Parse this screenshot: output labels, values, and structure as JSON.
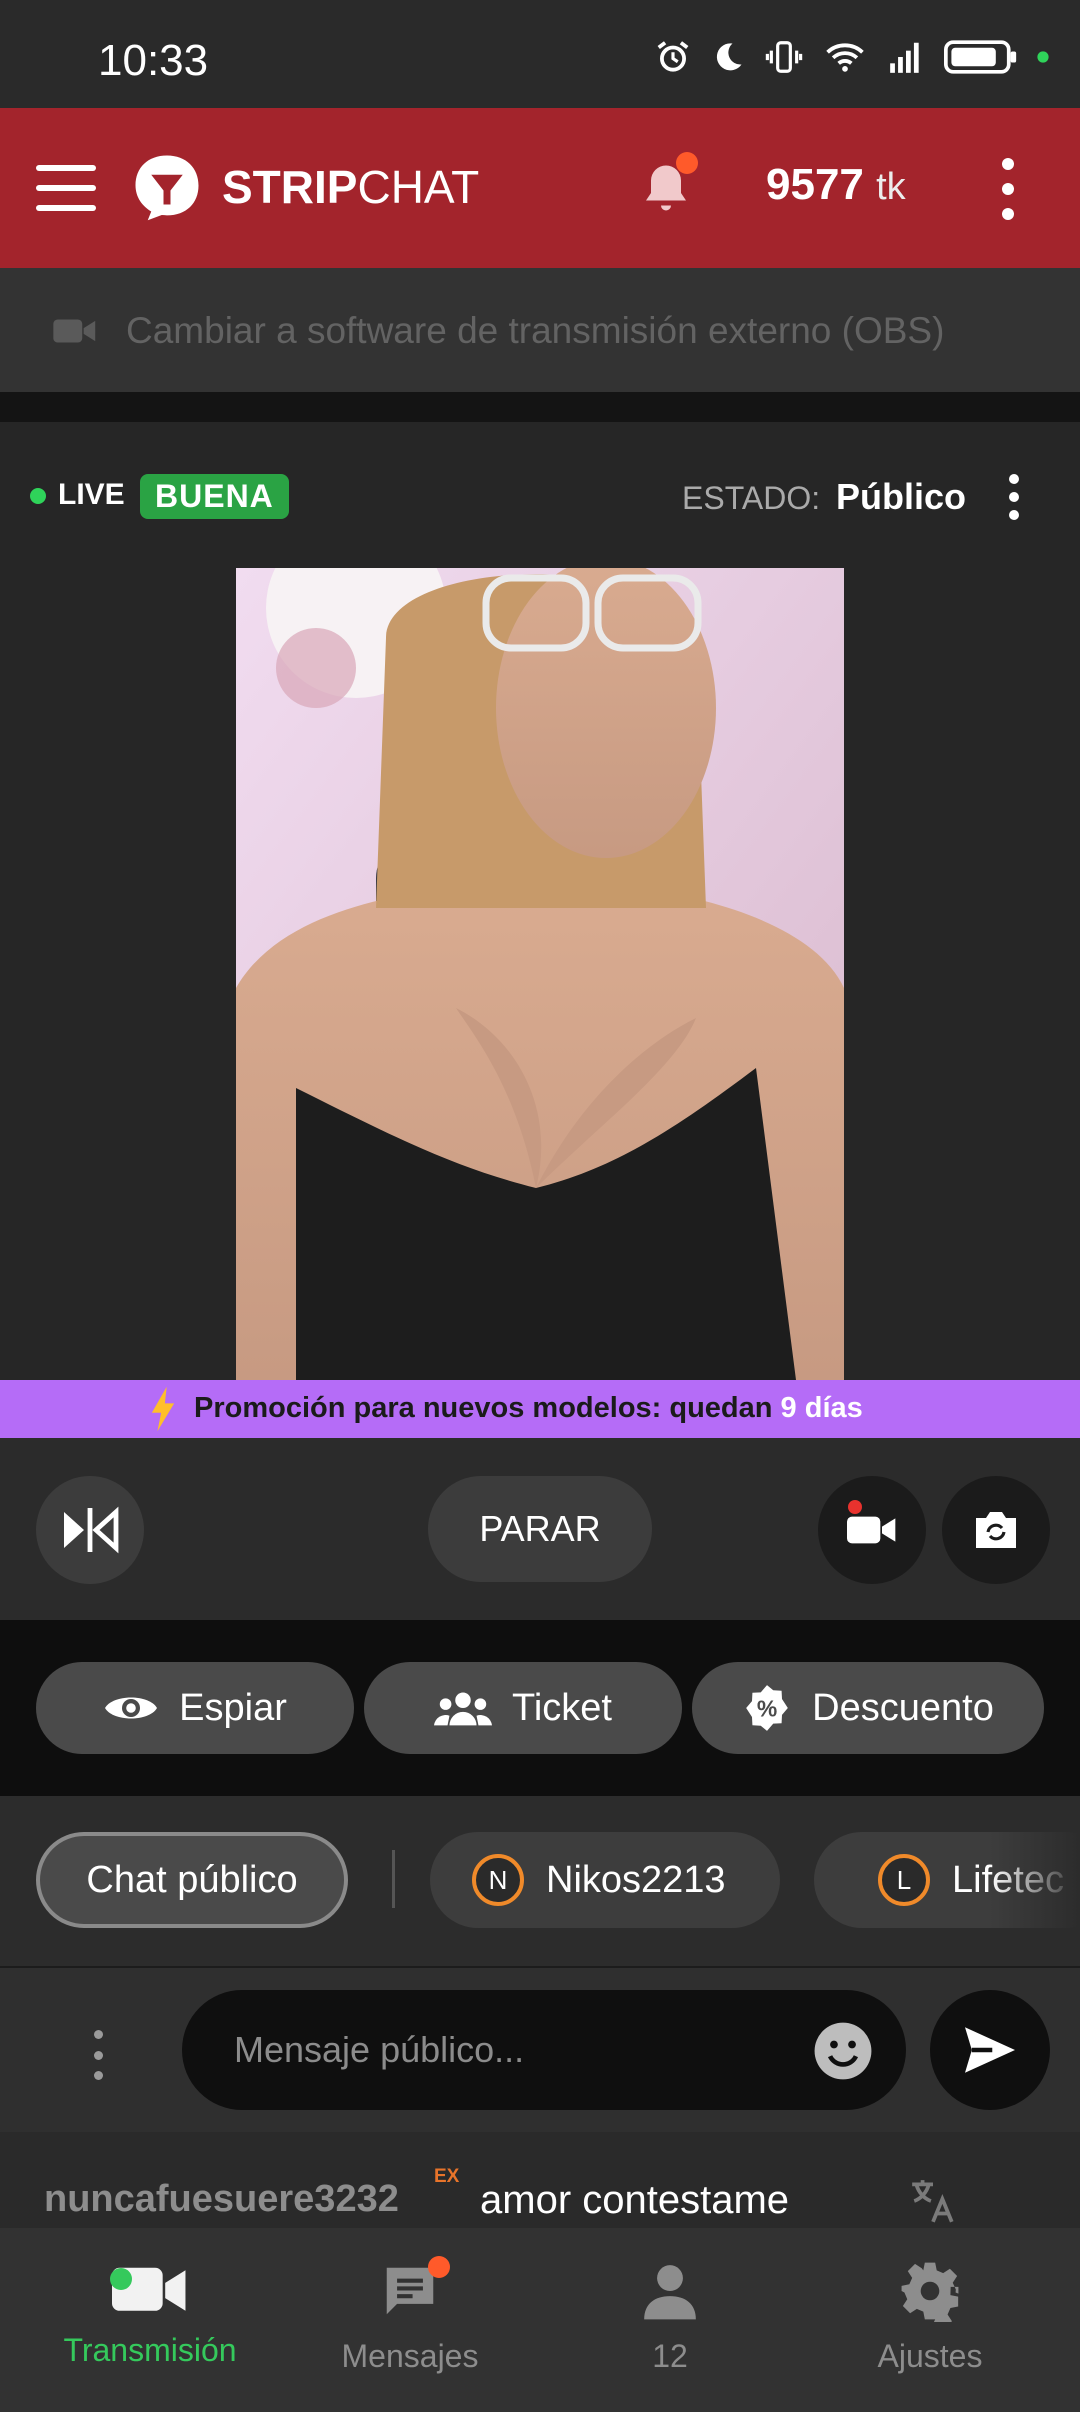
{
  "status_bar": {
    "time": "10:33"
  },
  "header": {
    "brand_part1": "STRIP",
    "brand_part2": "CHAT",
    "tokens_value": "9577",
    "tokens_unit": "tk"
  },
  "obs_bar": {
    "text": "Cambiar a software de transmisión externo (OBS)"
  },
  "live_row": {
    "live_label": "LIVE",
    "quality_badge": "BUENA",
    "estado_label": "ESTADO:",
    "estado_value": "Público"
  },
  "promo": {
    "text_before": "Promoción para nuevos modelos: quedan ",
    "days": "9 días"
  },
  "controls": {
    "stop_label": "PARAR"
  },
  "feature_pills": {
    "spy_label": "Espiar",
    "ticket_label": "Ticket",
    "discount_label": "Descuento"
  },
  "chat_tabs": {
    "public_label": "Chat público",
    "users": [
      {
        "initial": "N",
        "name": "Nikos2213"
      },
      {
        "initial": "L",
        "name": "Lifetec"
      }
    ]
  },
  "message_input": {
    "placeholder": "Mensaje público..."
  },
  "chat_message": {
    "username": "nuncafuesuere3232",
    "badge": "EX",
    "text": "amor contestame"
  },
  "bottom_nav": {
    "items": [
      {
        "label": "Transmisión",
        "icon": "video-camera-icon",
        "active": true
      },
      {
        "label": "Mensajes",
        "icon": "message-icon",
        "active": false
      },
      {
        "label": "12",
        "icon": "person-icon",
        "active": false
      },
      {
        "label": "Ajustes",
        "icon": "gear-icon",
        "active": false
      }
    ]
  },
  "colors": {
    "header_bg": "#a3242c",
    "quality_green": "#2aa344",
    "promo_purple": "#b56cf7",
    "active_green": "#35c95c",
    "notification_orange": "#ff5a2a"
  }
}
